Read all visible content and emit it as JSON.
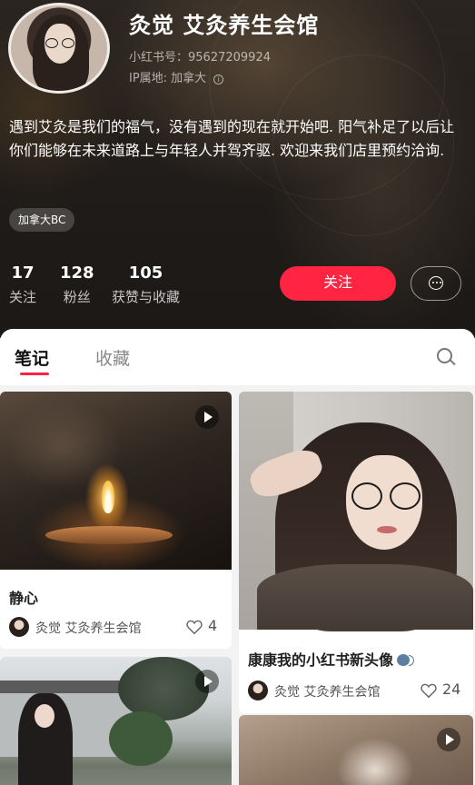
{
  "profile": {
    "nickname": "灸觉 艾灸养生会馆",
    "id_label": "小红书号：95627209924",
    "ip_label": "IP属地: 加拿大",
    "bio": "遇到艾灸是我们的福气，没有遇到的现在就开始吧. 阳气补足了以后让你们能够在未来道路上与年轻人并驾齐驱. 欢迎来我们店里预约洽询.",
    "tag": "加拿大BC",
    "stats": [
      {
        "num": "17",
        "label": "关注"
      },
      {
        "num": "128",
        "label": "粉丝"
      },
      {
        "num": "105",
        "label": "获赞与收藏"
      }
    ],
    "follow_label": "关注"
  },
  "tabs": {
    "notes": "笔记",
    "collect": "收藏"
  },
  "notes": [
    {
      "title": "静心",
      "author": "灸觉 艾灸养生会馆",
      "likes": "4",
      "is_video": true
    },
    {
      "title": "康康我的小红书新头像",
      "author": "灸觉 艾灸养生会馆",
      "likes": "24",
      "is_video": false
    },
    {
      "title": "",
      "author": "",
      "likes": "",
      "is_video": true
    },
    {
      "title": "",
      "author": "",
      "likes": "",
      "is_video": true
    }
  ],
  "colors": {
    "accent": "#ff2442",
    "header_bg": "#221e1a"
  },
  "icons": {
    "info": "info-icon",
    "message": "message-icon",
    "search": "search-icon",
    "play": "play-icon",
    "heart": "heart-icon",
    "speaker_emoji": "speaking-head-emoji"
  }
}
